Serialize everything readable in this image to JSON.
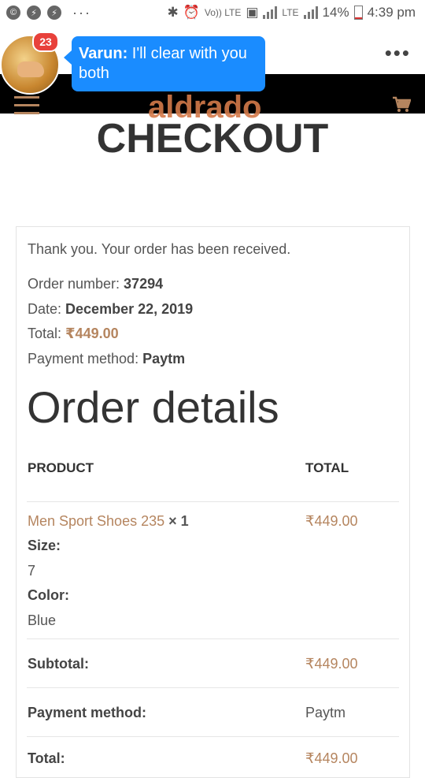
{
  "status_bar": {
    "dots": "···",
    "volte": "Vo)) LTE",
    "lte": "LTE",
    "battery": "14%",
    "time": "4:39 pm"
  },
  "chat": {
    "badge_count": "23",
    "sender": "Varun:",
    "message": " I'll clear with you both"
  },
  "header": {
    "logo": "aldrado"
  },
  "page_title": "CHECKOUT",
  "order": {
    "thanks": "Thank you. Your order has been received.",
    "number_label": "Order number: ",
    "number": "37294",
    "date_label": "Date: ",
    "date": "December 22, 2019",
    "total_label": "Total: ",
    "total": "₹449.00",
    "payment_label": "Payment method: ",
    "payment": "Paytm"
  },
  "details": {
    "title": "Order details",
    "col_product": "PRODUCT",
    "col_total": "TOTAL",
    "item": {
      "name": "Men Sport Shoes 235",
      "qty": " × 1",
      "price": "₹449.00",
      "size_label": "Size:",
      "size": "7",
      "color_label": "Color:",
      "color": "Blue"
    },
    "subtotal_label": "Subtotal:",
    "subtotal": "₹449.00",
    "payment_label": "Payment method:",
    "payment": "Paytm",
    "total_label": "Total:",
    "total": "₹449.00"
  }
}
